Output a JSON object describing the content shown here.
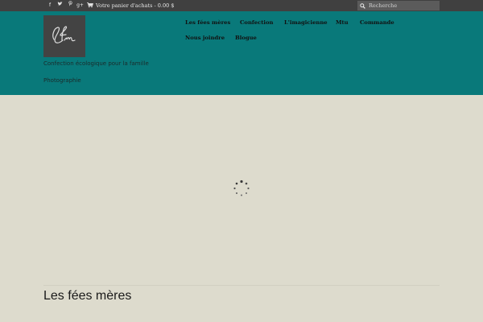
{
  "topbar": {
    "social": [
      {
        "name": "facebook-icon",
        "glyph": "f"
      },
      {
        "name": "twitter-icon",
        "glyph": "ᵥ"
      },
      {
        "name": "pinterest-icon",
        "glyph": "ᵖ"
      },
      {
        "name": "google-plus-icon",
        "glyph": "g⁺"
      }
    ],
    "cart_label": "Votre panier d'achats - 0.00 $",
    "search_placeholder": "Recherche"
  },
  "header": {
    "logo_text": "Lfm",
    "tagline": "Confection écologique pour la famille",
    "photo_link": "Photographie",
    "background": "#09797a"
  },
  "nav": {
    "items": [
      "Les fées mères",
      "Confection",
      "L'imagicienne",
      "Mtu",
      "Commande",
      "Nous joindre",
      "Blogue"
    ]
  },
  "main": {
    "section_title": "Les fées mères"
  },
  "colors": {
    "topbar": "#404040",
    "header": "#09797a",
    "page": "#dddbcd"
  }
}
